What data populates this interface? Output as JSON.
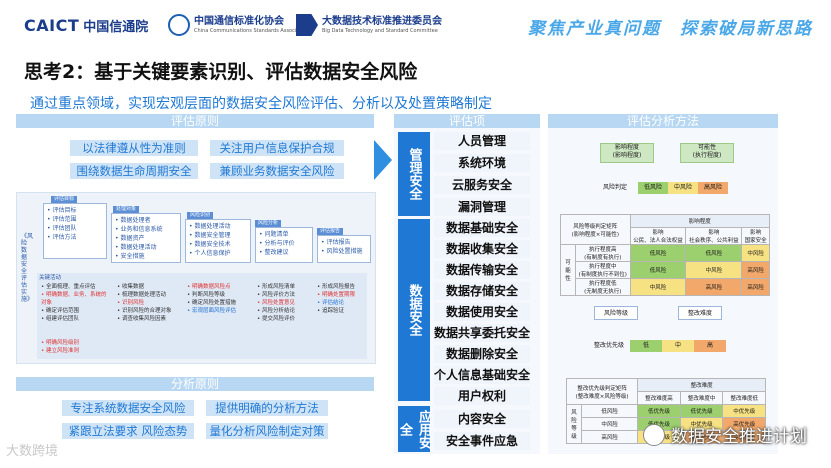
{
  "header": {
    "logo1_a": "CAICT",
    "logo1_b": "中国信通院",
    "logo2_top": "中国通信标准化协会",
    "logo2_bot": "China Communications Standards Association",
    "logo3_top": "大数据技术标准推进委员会",
    "logo3_bot": "Big Data Technology and Standard Committee",
    "slogan": "聚焦产业真问题　探索破局新思路"
  },
  "title": "思考2：基于关键要素识别、评估数据安全风险",
  "subtitle": "通过重点领域，实现宏观层面的数据安全风险评估、分析以及处置策略制定",
  "left": {
    "header_top": "评估原则",
    "principles_top": [
      "以法律遵从性为准则",
      "关注用户信息保护合规",
      "围绕数据生命周期安全",
      "兼顾业务数据安全风险"
    ],
    "header_bottom": "分析原则",
    "principles_bottom": [
      "专注系统数据安全风险",
      "提供明确的分析方法",
      "紧跟立法要求 风险态势",
      "量化分析风险制定对策"
    ],
    "diagram": {
      "side_label": "《风险数据安全评估实施》",
      "tags": [
        "评估目标",
        "处理对象",
        "风险识别",
        "风险分析",
        "评估报告"
      ],
      "col1": [
        "• 评估目标",
        "• 评估范围",
        "• 评估团队",
        "• 评估方法"
      ],
      "col2": [
        "• 数据处理者",
        "• 业务和信息系统",
        "• 数据资产",
        "• 数据处理活动",
        "• 安全措施"
      ],
      "col3": [
        "• 数据处理活动",
        "• 数据安全管理",
        "• 数据安全技术",
        "• 个人信息保护"
      ],
      "col4": [
        "• 问题清单",
        "• 分析与评价",
        "• 整改建议"
      ],
      "col5": [
        "• 评估报告",
        "• 风险处置措施"
      ],
      "flow_title": "关键活动",
      "flow1": [
        "• 全面梳理、重点评估",
        "• 明确数据、业务、系统的对象",
        "• 确定评估范围",
        "• 组建评估团队"
      ],
      "flow2": [
        "• 收集数据",
        "• 梳理数据处理活动",
        "• 识别风险",
        "• 识别风险的合理对象",
        "• 调查收集风险因素"
      ],
      "flow3": [
        "• 明确数据风险点",
        "• 判断风险等级",
        "• 确定风险处置措施",
        "• 宏观层面风险评估"
      ],
      "flow4": [
        "• 形成风险清单",
        "• 风险评价方法",
        "• 风险处置意见",
        "• 风险分析结论",
        "• 提交风险评价"
      ],
      "flow5": [
        "• 形成风险报告",
        "• 明确处置期限",
        "• 评估结论",
        "• 追踪验证"
      ],
      "flow_extra": [
        "• 明确风险级别",
        "• 建立风险准则"
      ]
    }
  },
  "middle": {
    "header": "评估项",
    "groups": [
      {
        "label": "管理安全",
        "items": [
          "人员管理",
          "系统环境",
          "云服务安全",
          "漏洞管理"
        ]
      },
      {
        "label": "数据安全",
        "items": [
          "数据基础安全",
          "数据收集安全",
          "数据传输安全",
          "数据存储安全",
          "数据使用安全",
          "数据共享委托安全",
          "数据删除安全",
          "个人信息基础安全",
          "用户权利"
        ]
      },
      {
        "label": "应用安全",
        "items": [
          "内容安全",
          "安全事件应急"
        ]
      }
    ]
  },
  "right": {
    "header": "评估分析方法",
    "impact": "影响程度\n(影响程度)",
    "possibility": "可能性\n(执行程度)",
    "risk_judge": "风险判定",
    "level_low": "低风险",
    "level_mid": "中风险",
    "level_high": "高风险",
    "table1_title": "风险等级判定矩阵\n(影响程度×可能性)",
    "table1_col_header": "影响程度",
    "table1_cols": [
      "影响\n公民、法人合法权益",
      "影响\n社会秩序、公共利益",
      "影响\n国家安全"
    ],
    "table1_row_header": "可能性",
    "table1_rows": [
      {
        "label": "执行程度高\n(有制度有执行)",
        "cells": [
          "低风险",
          "低风险",
          "中风险"
        ]
      },
      {
        "label": "执行程度中\n(有制度执行不到位)",
        "cells": [
          "低风险",
          "中风险",
          "高风险"
        ]
      },
      {
        "label": "执行程度低\n(无制度无执行)",
        "cells": [
          "中风险",
          "高风险",
          "高风险"
        ]
      }
    ],
    "risk_level": "风险等级",
    "fix_difficulty": "整改难度",
    "priority": "整改优先级",
    "pr_low": "低",
    "pr_mid": "中",
    "pr_high": "高",
    "table2_title": "整改优先级判定矩阵\n(整改难度×风险等级)",
    "table2_col_header": "整改难度",
    "table2_cols": [
      "整改难度高",
      "整改难度中",
      "整改难度低"
    ],
    "table2_row_header": "风险等级",
    "table2_rows": [
      {
        "label": "低风险",
        "cells": [
          "低优先级",
          "低优先级",
          "中优先级"
        ]
      },
      {
        "label": "中风险",
        "cells": [
          "低优先级",
          "中优先级",
          "高优先级"
        ]
      },
      {
        "label": "高风险",
        "cells": [
          "中优先级",
          "高优先级",
          "高优先级"
        ]
      }
    ]
  },
  "footer": {
    "watermark": "大数跨境",
    "wechat": "数据安全推进计划"
  }
}
